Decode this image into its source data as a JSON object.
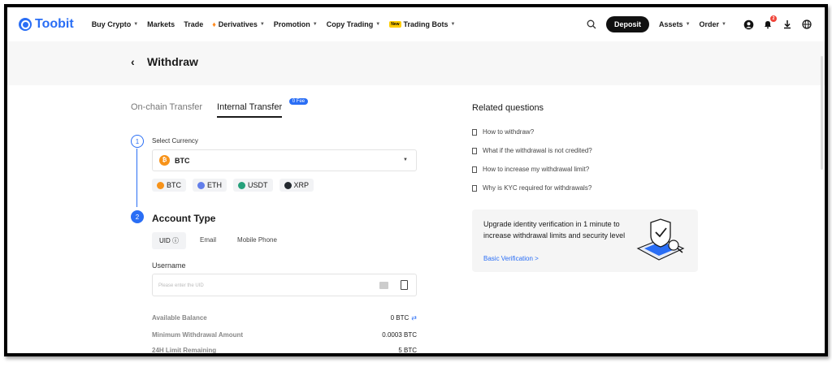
{
  "brand": {
    "name": "Toobit",
    "color": "#2a6ef5"
  },
  "nav": {
    "items": [
      {
        "label": "Buy Crypto",
        "caret": true
      },
      {
        "label": "Markets",
        "caret": false
      },
      {
        "label": "Trade",
        "caret": false
      },
      {
        "label": "Derivatives",
        "caret": true,
        "icon": "flame-icon"
      },
      {
        "label": "Promotion",
        "caret": true
      },
      {
        "label": "Copy Trading",
        "caret": true
      },
      {
        "label": "Trading Bots",
        "caret": true,
        "badge": "New"
      }
    ],
    "deposit_label": "Deposit",
    "assets_label": "Assets",
    "order_label": "Order",
    "notification_count": "2"
  },
  "page": {
    "title": "Withdraw"
  },
  "tabs": [
    {
      "label": "On-chain Transfer",
      "active": false
    },
    {
      "label": "Internal Transfer",
      "active": true,
      "badge": "0 Fee"
    }
  ],
  "step1": {
    "number": "1",
    "label": "Select Currency",
    "selected": "BTC",
    "quick_coins": [
      {
        "symbol": "BTC",
        "color": "#f7931a"
      },
      {
        "symbol": "ETH",
        "color": "#627eea"
      },
      {
        "symbol": "USDT",
        "color": "#26a17b"
      },
      {
        "symbol": "XRP",
        "color": "#23292f"
      }
    ]
  },
  "step2": {
    "number": "2",
    "title": "Account Type",
    "account_tabs": [
      {
        "label": "UID",
        "active": true
      },
      {
        "label": "Email",
        "active": false
      },
      {
        "label": "Mobile Phone",
        "active": false
      }
    ],
    "username_label": "Username",
    "username_placeholder": "Please enter the UID",
    "info": [
      {
        "key": "Available Balance",
        "value": "0 BTC"
      },
      {
        "key": "Minimum Withdrawal Amount",
        "value": "0.0003 BTC"
      },
      {
        "key": "24H Limit Remaining",
        "value": "5 BTC"
      }
    ]
  },
  "related": {
    "title": "Related questions",
    "items": [
      "How to withdraw?",
      "What if the withdrawal is not credited?",
      "How to increase my withdrawal limit?",
      "Why is KYC required for withdrawals?"
    ]
  },
  "promo": {
    "text": "Upgrade identity verification in 1 minute to increase withdrawal limits and security level",
    "link": "Basic Verification >"
  }
}
